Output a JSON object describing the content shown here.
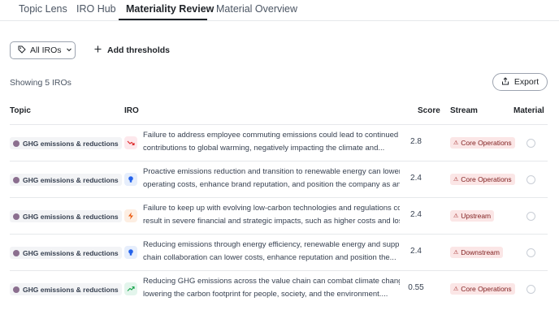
{
  "tabs": [
    {
      "label": "Topic Lens",
      "active": false
    },
    {
      "label": "IRO Hub",
      "active": false
    },
    {
      "label": "Materiality Review",
      "active": true
    },
    {
      "label": "Material Overview",
      "active": false
    }
  ],
  "toolbar": {
    "filter_label": "All IROs",
    "add_thresholds_label": "Add thresholds",
    "showing_label": "Showing 5 IROs",
    "export_label": "Export"
  },
  "table": {
    "headers": {
      "topic": "Topic",
      "iro": "IRO",
      "score": "Score",
      "stream": "Stream",
      "material": "Material"
    },
    "rows": [
      {
        "topic": "GHG emissions & reductions",
        "icon": "trend-down-icon",
        "line1": "Failure to address employee commuting emissions could lead to continued",
        "line2": "contributions to global warming, negatively impacting the climate and...",
        "score": "2.8",
        "stream": "Core Operations"
      },
      {
        "topic": "GHG emissions & reductions",
        "icon": "lightbulb-icon",
        "line1": "Proactive emissions reduction and transition to renewable energy can lower",
        "line2": "operating costs, enhance brand reputation, and position the company as an...",
        "score": "2.4",
        "stream": "Core Operations"
      },
      {
        "topic": "GHG emissions & reductions",
        "icon": "lightning-icon",
        "line1": "Failure to keep up with evolving low-carbon technologies and regulations could",
        "line2": "result in severe financial and strategic impacts, such as higher costs and loss ...",
        "score": "2.4",
        "stream": "Upstream"
      },
      {
        "topic": "GHG emissions & reductions",
        "icon": "lightbulb-icon",
        "line1": "Reducing emissions through energy efficiency, renewable energy and supply",
        "line2": "chain collaboration can lower costs, enhance reputation and position the...",
        "score": "2.4",
        "stream": "Downstream"
      },
      {
        "topic": "GHG emissions & reductions",
        "icon": "trend-up-icon",
        "line1": "Reducing GHG emissions across the value chain can combat climate change by",
        "line2": "lowering the carbon footprint for people, society, and the environment....",
        "score": "0.55",
        "stream": "Core Operations"
      }
    ]
  },
  "colors": {
    "stream_chip_bg": "#fbe6e6",
    "stream_chip_text": "#7f1d1d",
    "accent": "#1f2328"
  }
}
